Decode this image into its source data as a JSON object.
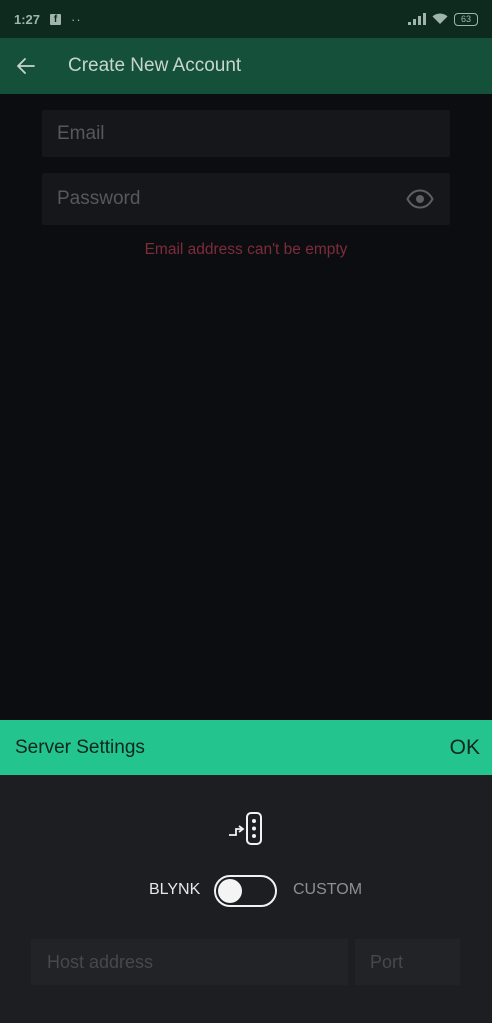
{
  "status_bar": {
    "time": "1:27",
    "notification_icons": [
      "facebook-icon",
      "dots-icon"
    ],
    "facebook_glyph": "f",
    "dots": "··",
    "battery": "63"
  },
  "app_bar": {
    "title": "Create New Account",
    "back_icon": "arrow-left-icon"
  },
  "form": {
    "email_placeholder": "Email",
    "email_value": "",
    "password_placeholder": "Password",
    "password_value": "",
    "error_message": "Email address can't be empty"
  },
  "server_settings": {
    "title": "Server Settings",
    "ok_label": "OK",
    "toggle_left_label": "BLYNK",
    "toggle_right_label": "CUSTOM",
    "toggle_state": "BLYNK",
    "host_placeholder": "Host address",
    "host_value": "",
    "port_placeholder": "Port",
    "port_value": ""
  },
  "colors": {
    "status_bar": "#0e2a1f",
    "app_bar": "#15503a",
    "accent": "#23c48e",
    "error": "#7d2c3c",
    "background": "#0c0d10",
    "sheet_background": "#1d1e22"
  }
}
